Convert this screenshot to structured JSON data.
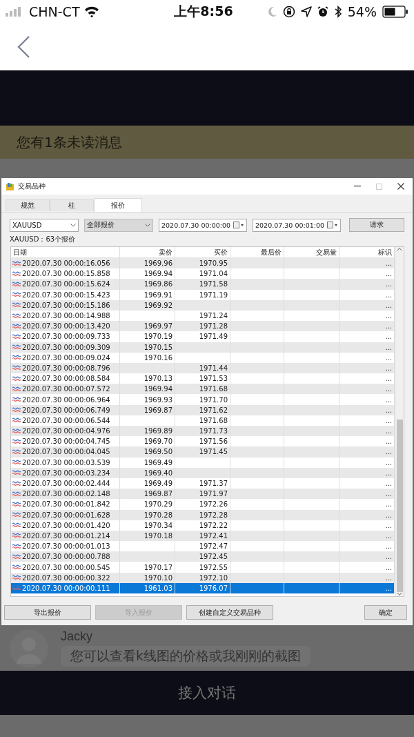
{
  "status_bar": {
    "carrier": "CHN-CT",
    "time": "上午8:56",
    "battery": "54%"
  },
  "banner": {
    "text": "您有1条未读消息"
  },
  "dialog": {
    "title": "交易品种",
    "tabs": [
      {
        "label": "规范",
        "selected": false
      },
      {
        "label": "柱",
        "selected": false
      },
      {
        "label": "报价",
        "selected": true
      }
    ],
    "symbol_select": {
      "value": "XAUUSD",
      "editable": true
    },
    "type_select": {
      "value": "全部报价",
      "editable": false
    },
    "from_date": {
      "value": "2020.07.30 00:00:00"
    },
    "to_date": {
      "value": "2020.07.30 00:01:00"
    },
    "request_button": {
      "label": "请求"
    },
    "summary": "XAUUSD：63个报价",
    "table": {
      "columns": [
        "日期",
        "卖价",
        "买价",
        "最后价",
        "交易量",
        "标识"
      ],
      "rows": [
        {
          "date": "2020.07.30 00:00:16.056",
          "bid": "1969.96",
          "ask": "1970.95",
          "flag": "...",
          "selected": false
        },
        {
          "date": "2020.07.30 00:00:15.858",
          "bid": "1969.94",
          "ask": "1971.04",
          "flag": "...",
          "selected": false
        },
        {
          "date": "2020.07.30 00:00:15.624",
          "bid": "1969.86",
          "ask": "1971.58",
          "flag": "...",
          "selected": false
        },
        {
          "date": "2020.07.30 00:00:15.423",
          "bid": "1969.91",
          "ask": "1971.19",
          "flag": "...",
          "selected": false
        },
        {
          "date": "2020.07.30 00:00:15.186",
          "bid": "1969.92",
          "flag": "...",
          "selected": false
        },
        {
          "date": "2020.07.30 00:00:14.988",
          "ask": "1971.24",
          "flag": "...",
          "selected": false
        },
        {
          "date": "2020.07.30 00:00:13.420",
          "bid": "1969.97",
          "ask": "1971.28",
          "flag": "...",
          "selected": false
        },
        {
          "date": "2020.07.30 00:00:09.733",
          "bid": "1970.19",
          "ask": "1971.49",
          "flag": "...",
          "selected": false
        },
        {
          "date": "2020.07.30 00:00:09.309",
          "bid": "1970.15",
          "flag": "...",
          "selected": false
        },
        {
          "date": "2020.07.30 00:00:09.024",
          "bid": "1970.16",
          "flag": "...",
          "selected": false
        },
        {
          "date": "2020.07.30 00:00:08.796",
          "ask": "1971.44",
          "flag": "...",
          "selected": false
        },
        {
          "date": "2020.07.30 00:00:08.584",
          "bid": "1970.13",
          "ask": "1971.53",
          "flag": "...",
          "selected": false
        },
        {
          "date": "2020.07.30 00:00:07.572",
          "bid": "1969.94",
          "ask": "1971.68",
          "flag": "...",
          "selected": false
        },
        {
          "date": "2020.07.30 00:00:06.964",
          "bid": "1969.93",
          "ask": "1971.70",
          "flag": "...",
          "selected": false
        },
        {
          "date": "2020.07.30 00:00:06.749",
          "bid": "1969.87",
          "ask": "1971.62",
          "flag": "...",
          "selected": false
        },
        {
          "date": "2020.07.30 00:00:06.544",
          "ask": "1971.68",
          "flag": "...",
          "selected": false
        },
        {
          "date": "2020.07.30 00:00:04.976",
          "bid": "1969.89",
          "ask": "1971.73",
          "flag": "...",
          "selected": false
        },
        {
          "date": "2020.07.30 00:00:04.745",
          "bid": "1969.70",
          "ask": "1971.56",
          "flag": "...",
          "selected": false
        },
        {
          "date": "2020.07.30 00:00:04.045",
          "bid": "1969.50",
          "ask": "1971.45",
          "flag": "...",
          "selected": false
        },
        {
          "date": "2020.07.30 00:00:03.539",
          "bid": "1969.49",
          "flag": "...",
          "selected": false
        },
        {
          "date": "2020.07.30 00:00:03.234",
          "bid": "1969.40",
          "flag": "...",
          "selected": false
        },
        {
          "date": "2020.07.30 00:00:02.444",
          "bid": "1969.49",
          "ask": "1971.37",
          "flag": "...",
          "selected": false
        },
        {
          "date": "2020.07.30 00:00:02.148",
          "bid": "1969.87",
          "ask": "1971.97",
          "flag": "...",
          "selected": false
        },
        {
          "date": "2020.07.30 00:00:01.842",
          "bid": "1970.29",
          "ask": "1972.26",
          "flag": "...",
          "selected": false
        },
        {
          "date": "2020.07.30 00:00:01.628",
          "bid": "1970.28",
          "ask": "1972.28",
          "flag": "...",
          "selected": false
        },
        {
          "date": "2020.07.30 00:00:01.420",
          "bid": "1970.34",
          "ask": "1972.22",
          "flag": "...",
          "selected": false
        },
        {
          "date": "2020.07.30 00:00:01.214",
          "bid": "1970.18",
          "ask": "1972.41",
          "flag": "...",
          "selected": false
        },
        {
          "date": "2020.07.30 00:00:01.013",
          "ask": "1972.47",
          "flag": "...",
          "selected": false
        },
        {
          "date": "2020.07.30 00:00:00.788",
          "ask": "1972.45",
          "flag": "...",
          "selected": false
        },
        {
          "date": "2020.07.30 00:00:00.545",
          "bid": "1970.17",
          "ask": "1972.55",
          "flag": "...",
          "selected": false
        },
        {
          "date": "2020.07.30 00:00:00.322",
          "bid": "1970.10",
          "ask": "1972.10",
          "flag": "...",
          "selected": false
        },
        {
          "date": "2020.07.30 00:00:00.111",
          "bid": "1961.03",
          "ask": "1976.07",
          "flag": "...",
          "selected": true
        }
      ]
    },
    "buttons": [
      {
        "label": "导出报价",
        "disabled": false
      },
      {
        "label": "导入报价",
        "disabled": true
      },
      {
        "label": "创建自定义交易品种",
        "disabled": false
      },
      {
        "label": "确定",
        "disabled": false
      }
    ]
  },
  "chat": {
    "sender": "Jacky",
    "message": "您可以查看k线图的价格或我刚刚的截图"
  },
  "action_bar": {
    "label": "接入对话"
  }
}
